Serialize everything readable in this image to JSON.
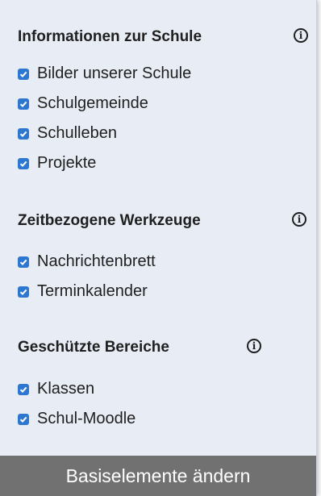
{
  "sections": [
    {
      "title": "Informationen zur Schule",
      "info_icon": "info-circle",
      "items": [
        {
          "label": "Bilder unserer Schule",
          "checked": true
        },
        {
          "label": "Schulgemeinde",
          "checked": true
        },
        {
          "label": "Schulleben",
          "checked": true
        },
        {
          "label": "Projekte",
          "checked": true
        }
      ]
    },
    {
      "title": "Zeitbezogene Werkzeuge",
      "info_icon": "info-circle",
      "items": [
        {
          "label": "Nachrichtenbrett",
          "checked": true
        },
        {
          "label": "Terminkalender",
          "checked": true
        }
      ]
    },
    {
      "title": "Geschützte Bereiche",
      "info_icon": "info-circle",
      "items": [
        {
          "label": "Klassen",
          "checked": true
        },
        {
          "label": "Schul-Moodle",
          "checked": true
        }
      ]
    }
  ],
  "footer": {
    "button_label": "Basiselemente ändern"
  },
  "colors": {
    "panel_background": "#e8edf5",
    "checkbox": "#2e77d0",
    "footer_background": "#717171"
  }
}
